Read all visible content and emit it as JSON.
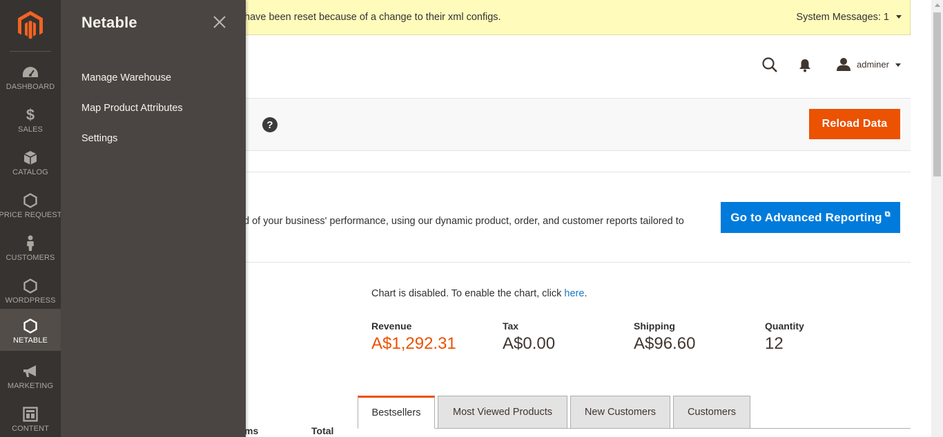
{
  "nav": {
    "items": [
      {
        "label": "DASHBOARD",
        "icon": "dashboard-icon"
      },
      {
        "label": "SALES",
        "icon": "dollar-icon"
      },
      {
        "label": "CATALOG",
        "icon": "box-icon"
      },
      {
        "label": "PRICE REQUEST",
        "icon": "hexagon-icon"
      },
      {
        "label": "CUSTOMERS",
        "icon": "person-icon"
      },
      {
        "label": "WORDPRESS",
        "icon": "hexagon-icon"
      },
      {
        "label": "NETABLE",
        "icon": "hexagon-icon",
        "active": true
      },
      {
        "label": "MARKETING",
        "icon": "megaphone-icon"
      },
      {
        "label": "CONTENT",
        "icon": "layout-icon"
      }
    ]
  },
  "flyout": {
    "title": "Netable",
    "links": [
      "Manage Warehouse",
      "Map Product Attributes",
      "Settings"
    ]
  },
  "system_message": {
    "text": "have been reset because of a change to their xml configs.",
    "count_label": "System Messages: 1"
  },
  "header": {
    "user": "adminer"
  },
  "actions": {
    "reload": "Reload Data",
    "help": "?"
  },
  "advanced": {
    "text": "d of your business' performance, using our dynamic product, order, and customer reports tailored to",
    "button": "Go to Advanced Reporting",
    "ext_glyph": "⧉"
  },
  "chart_note": {
    "prefix": "Chart is disabled. To enable the chart, click ",
    "link": "here",
    "suffix": "."
  },
  "metrics": [
    {
      "label": "Revenue",
      "value": "A$1,292.31"
    },
    {
      "label": "Tax",
      "value": "A$0.00"
    },
    {
      "label": "Shipping",
      "value": "A$96.60"
    },
    {
      "label": "Quantity",
      "value": "12"
    }
  ],
  "tabs": [
    "Bestsellers",
    "Most Viewed Products",
    "New Customers",
    "Customers"
  ],
  "table_cols": [
    "ms",
    "Total"
  ],
  "colors": {
    "nav_bg": "#373330",
    "flyout_bg": "#4a4542",
    "accent_orange": "#eb5202",
    "link_blue": "#1979c3",
    "button_blue": "#007bdb",
    "message_bg": "#fffbbb"
  }
}
